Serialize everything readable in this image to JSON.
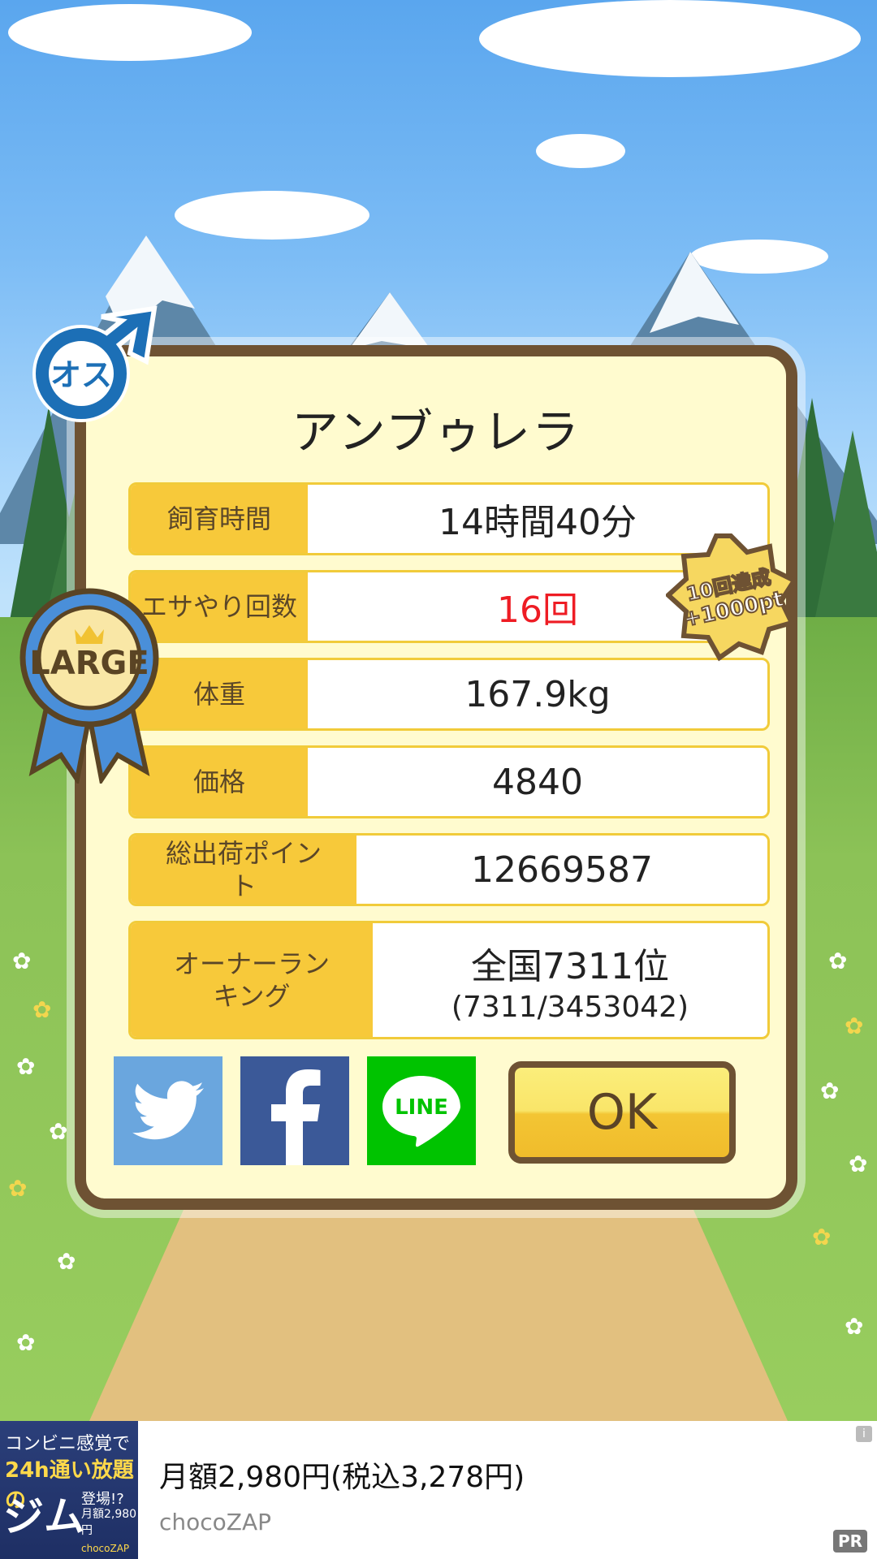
{
  "result": {
    "name": "アンブゥレラ",
    "rows": [
      {
        "label": "飼育時間",
        "value": "14時間40分"
      },
      {
        "label": "エサやり回数",
        "value": "16回"
      },
      {
        "label": "体重",
        "value": "167.9kg"
      },
      {
        "label": "価格",
        "value": "4840"
      },
      {
        "label": "総出荷ポイント",
        "value": "12669587"
      },
      {
        "label": "オーナーランキング",
        "value": "全国7311位",
        "sub": "(7311/3453042)"
      }
    ],
    "ok_label": "OK"
  },
  "badges": {
    "gender": "オス",
    "size": "LARGE",
    "bonus_line1": "10回達成",
    "bonus_line2": "+1000pt"
  },
  "share": {
    "line_label": "LINE"
  },
  "ad": {
    "image_text1": "コンビニ感覚で",
    "image_text2": "24h通い放題の",
    "image_text3": "ジム",
    "image_text4": "登場!?",
    "image_text5": "月額2,980円",
    "image_text6": "chocoZAP",
    "title": "月額2,980円(税込3,278円)",
    "advertiser": "chocoZAP",
    "pr_label": "PR",
    "info_label": "i"
  },
  "colors": {
    "card_border": "#6e5233",
    "label_bg": "#f7c93a",
    "highlight_red": "#ee1c24",
    "twitter": "#55acee",
    "facebook": "#3b5998",
    "line": "#00c300"
  }
}
